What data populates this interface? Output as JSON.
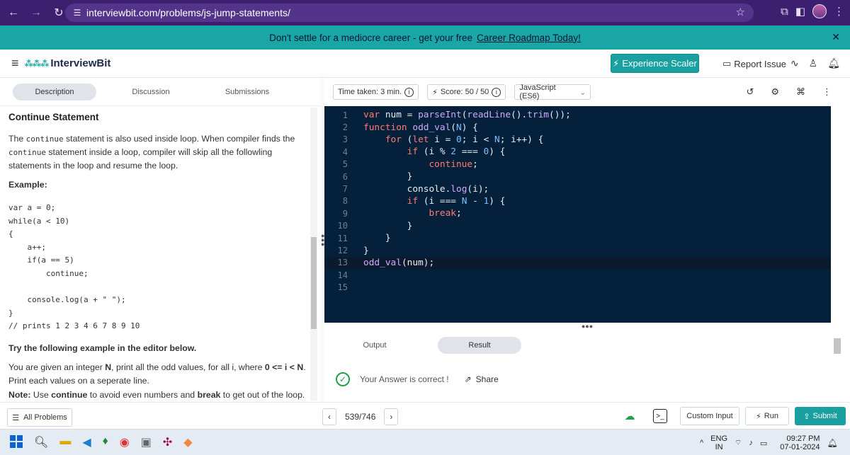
{
  "browser": {
    "url": "interviewbit.com/problems/js-jump-statements/"
  },
  "banner": {
    "text": "Don't settle for a mediocre career - get your free",
    "link": "Career Roadmap Today!"
  },
  "header": {
    "logo_text": "InterviewBit",
    "experience_button": "Experience Scaler",
    "report_issue": "Report Issue"
  },
  "left_tabs": [
    "Description",
    "Discussion",
    "Submissions"
  ],
  "description": {
    "title": "Continue Statement",
    "para_pre": "The ",
    "para_code1": "continue",
    "para_mid": " statement is also used inside loop. When compiler finds the ",
    "para_code2": "continue",
    "para_post": " statement inside a loop, compiler will skip all the followling statements in the loop and resume the loop.",
    "example_label": "Example:",
    "example_code": "var a = 0;\nwhile(a < 10)\n{\n    a++;\n    if(a == 5)\n        continue;\n\n    console.log(a + \" \");\n}\n// prints 1 2 3 4 6 7 8 9 10",
    "try_heading": "Try the following example in the editor below.",
    "given_pre": "You are given an integer ",
    "given_n": "N",
    "given_mid": ", print all the odd values, for all i, where ",
    "given_cond": "0 <= i < N",
    "given_post": ". Print each values on a seperate line.",
    "note_label": "Note:",
    "note_pre": " Use ",
    "note_continue": "continue",
    "note_mid": " to avoid even numbers and ",
    "note_break": "break",
    "note_post": " to get out of the loop."
  },
  "editor_top": {
    "time_taken": "Time taken: 3 min.",
    "score": "Score: 50 / 50",
    "language": "JavaScript (ES6)"
  },
  "code_lines": [
    "var num = parseInt(readLine().trim());",
    "function odd_val(N) {",
    "    for (let i = 0; i < N; i++) {",
    "        if (i % 2 === 0) {",
    "            continue;",
    "        }",
    "        console.log(i);",
    "        if (i === N - 1) {",
    "            break;",
    "        }",
    "    }",
    "}",
    "odd_val(num);",
    "",
    ""
  ],
  "line_numbers": [
    "1",
    "2",
    "3",
    "4",
    "5",
    "6",
    "7",
    "8",
    "9",
    "10",
    "11",
    "12",
    "13",
    "14",
    "15"
  ],
  "output": {
    "tabs": [
      "Output",
      "Result"
    ],
    "result_text": "Your Answer is correct !",
    "share": "Share"
  },
  "bottom": {
    "all_problems": "All Problems",
    "pager": "539/746",
    "custom_input": "Custom Input",
    "run": "Run",
    "submit": "Submit"
  },
  "taskbar": {
    "lang_top": "ENG",
    "lang_bottom": "IN",
    "time": "09:27 PM",
    "date": "07-01-2024"
  }
}
